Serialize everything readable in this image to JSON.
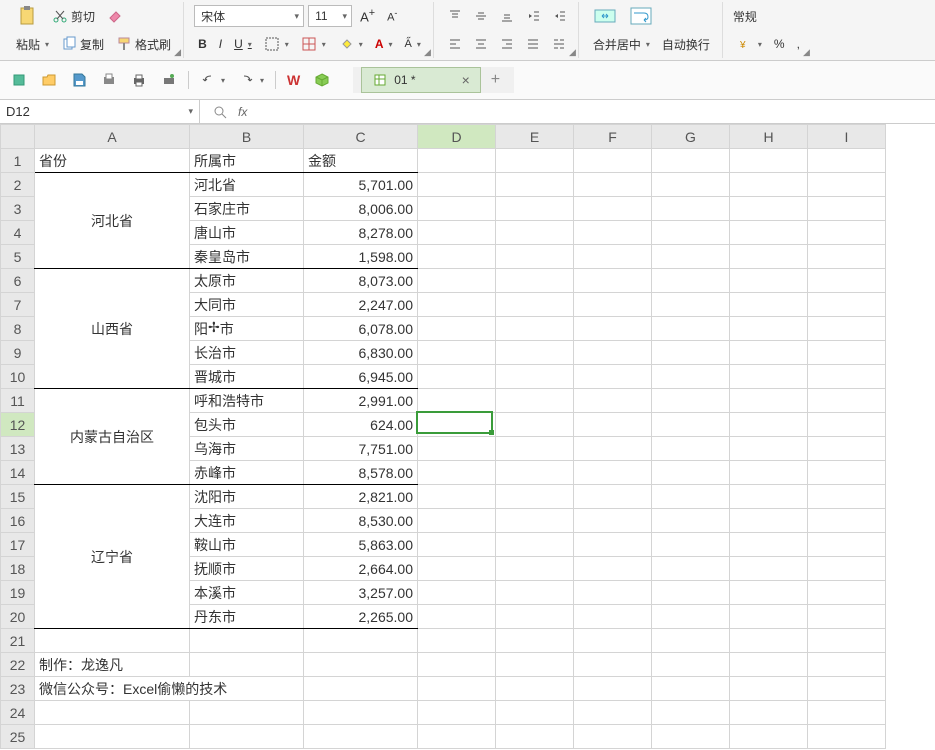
{
  "ribbon": {
    "paste": "粘贴",
    "cut": "剪切",
    "copy": "复制",
    "painter": "格式刷",
    "font_name": "宋体",
    "font_size": "11",
    "merge": "合并居中",
    "wrap": "自动换行",
    "number_format": "常规",
    "percent": "%"
  },
  "doc": {
    "tab_name": "01 *"
  },
  "namebox": {
    "ref": "D12"
  },
  "columns": [
    "A",
    "B",
    "C",
    "D",
    "E",
    "F",
    "G",
    "H",
    "I"
  ],
  "active": {
    "row": 12,
    "col": "D"
  },
  "headers": {
    "prov": "省份",
    "city": "所属市",
    "amount": "金额"
  },
  "sections": [
    {
      "prov": "河北省",
      "rows": [
        {
          "city": "河北省",
          "amt": "5,701.00"
        },
        {
          "city": "石家庄市",
          "amt": "8,006.00"
        },
        {
          "city": "唐山市",
          "amt": "8,278.00"
        },
        {
          "city": "秦皇岛市",
          "amt": "1,598.00"
        }
      ]
    },
    {
      "prov": "山西省",
      "rows": [
        {
          "city": "太原市",
          "amt": "8,073.00"
        },
        {
          "city": "大同市",
          "amt": "2,247.00"
        },
        {
          "city": "阳泉市",
          "amt": "6,078.00"
        },
        {
          "city": "长治市",
          "amt": "6,830.00"
        },
        {
          "city": "晋城市",
          "amt": "6,945.00"
        }
      ]
    },
    {
      "prov": "内蒙古自治区",
      "rows": [
        {
          "city": "呼和浩特市",
          "amt": "2,991.00"
        },
        {
          "city": "包头市",
          "amt": "624.00"
        },
        {
          "city": "乌海市",
          "amt": "7,751.00"
        },
        {
          "city": "赤峰市",
          "amt": "8,578.00"
        }
      ]
    },
    {
      "prov": "辽宁省",
      "rows": [
        {
          "city": "沈阳市",
          "amt": "2,821.00"
        },
        {
          "city": "大连市",
          "amt": "8,530.00"
        },
        {
          "city": "鞍山市",
          "amt": "5,863.00"
        },
        {
          "city": "抚顺市",
          "amt": "2,664.00"
        },
        {
          "city": "本溪市",
          "amt": "3,257.00"
        },
        {
          "city": "丹东市",
          "amt": "2,265.00"
        }
      ]
    }
  ],
  "footer": {
    "author": "制作：龙逸凡",
    "wechat": "微信公众号：Excel偷懒的技术"
  },
  "cursor_cell": "⊹"
}
